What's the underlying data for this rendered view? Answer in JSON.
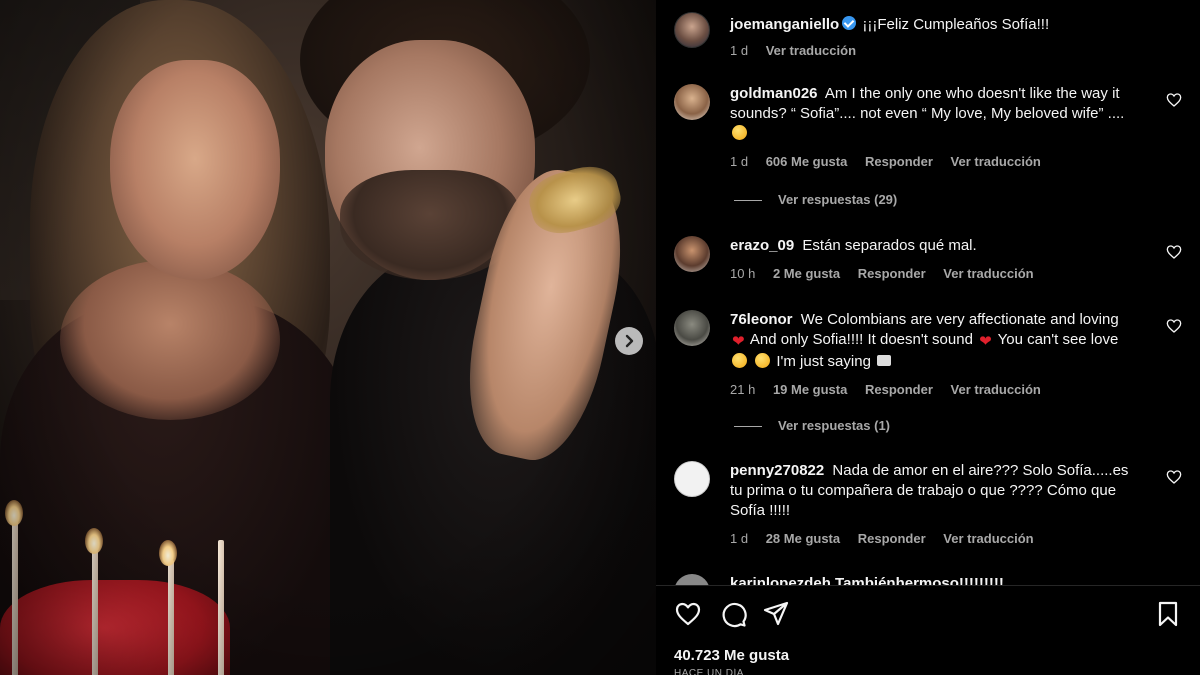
{
  "post": {
    "username": "joemanganiello",
    "caption": "¡¡¡Feliz Cumpleaños Sofía!!!",
    "time": "1 d",
    "translate": "Ver traducción"
  },
  "comments": [
    {
      "username": "goldman026",
      "text": "Am I the only one who doesn't like the way it sounds? “ Sofia”.... not even “ My love, My beloved wife” ....",
      "emoji": "woman-tipping-hand",
      "time": "1 d",
      "likes": "606 Me gusta",
      "reply": "Responder",
      "translate": "Ver traducción",
      "view_replies": "Ver respuestas (29)"
    },
    {
      "username": "erazo_09",
      "text": "Están separados qué mal.",
      "time": "10 h",
      "likes": "2 Me gusta",
      "reply": "Responder",
      "translate": "Ver traducción"
    },
    {
      "username": "76leonor",
      "text_1": "We Colombians are very affectionate and loving",
      "text_2": "And only Sofia!!!! It doesn't sound",
      "text_3": "You can't see love",
      "text_4": "I'm just saying",
      "time": "21 h",
      "likes": "19 Me gusta",
      "reply": "Responder",
      "translate": "Ver traducción",
      "view_replies": "Ver respuestas (1)"
    },
    {
      "username": "penny270822",
      "text": "Nada de amor en el aire??? Solo Sofía.....es tu prima o tu compañera de trabajo o que ???? Cómo que Sofía !!!!!",
      "time": "1 d",
      "likes": "28 Me gusta",
      "reply": "Responder",
      "translate": "Ver traducción"
    }
  ],
  "partial_comment": "karinlopezdeh Tambiénhermoso!!!!!!!!!",
  "footer": {
    "likes": "40.723 Me gusta",
    "ago": "HACE UN DÍA"
  },
  "icons": [
    "verified-badge",
    "heart-icon",
    "comment-icon",
    "share-icon",
    "bookmark-icon",
    "chevron-right-icon"
  ],
  "colors": {
    "background": "#000000",
    "text": "#f5f5f5",
    "muted": "#a8a8a8",
    "verified": "#3897f0",
    "heart_emoji": "#e0202c"
  }
}
